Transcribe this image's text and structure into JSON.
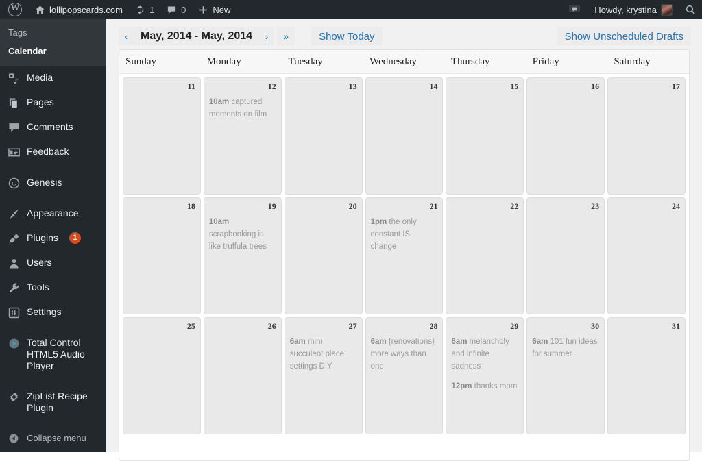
{
  "adminbar": {
    "logo_icon": "wordpress-logo-icon",
    "site_icon": "home-icon",
    "site_name": "lollipopscards.com",
    "updates_icon": "updates-icon",
    "updates_count": "1",
    "comments_icon": "comment-icon",
    "comments_count": "0",
    "new_icon": "plus-icon",
    "new_label": "New",
    "notifications_icon": "notification-bubble-icon",
    "howdy": "Howdy, krystina",
    "avatar_name": "avatar",
    "search_icon": "search-icon"
  },
  "sidebar": {
    "submenu": [
      {
        "label": "Tags",
        "current": false
      },
      {
        "label": "Calendar",
        "current": true
      }
    ],
    "items": [
      {
        "label": "Media",
        "icon": "media-icon",
        "badge": null,
        "sep_before": false
      },
      {
        "label": "Pages",
        "icon": "pages-icon",
        "badge": null,
        "sep_before": false
      },
      {
        "label": "Comments",
        "icon": "comments-icon",
        "badge": null,
        "sep_before": false
      },
      {
        "label": "Feedback",
        "icon": "feedback-icon",
        "badge": null,
        "sep_before": false
      },
      {
        "label": "Genesis",
        "icon": "genesis-icon",
        "badge": null,
        "sep_before": true
      },
      {
        "label": "Appearance",
        "icon": "appearance-icon",
        "badge": null,
        "sep_before": true
      },
      {
        "label": "Plugins",
        "icon": "plugins-icon",
        "badge": "1",
        "sep_before": false
      },
      {
        "label": "Users",
        "icon": "users-icon",
        "badge": null,
        "sep_before": false
      },
      {
        "label": "Tools",
        "icon": "tools-icon",
        "badge": null,
        "sep_before": false
      },
      {
        "label": "Settings",
        "icon": "settings-icon",
        "badge": null,
        "sep_before": false
      },
      {
        "label": "Total Control HTML5 Audio Player",
        "icon": "audio-player-icon",
        "badge": null,
        "sep_before": true
      },
      {
        "label": "ZipList Recipe Plugin",
        "icon": "ziplist-icon",
        "badge": null,
        "sep_before": true
      }
    ],
    "collapse": {
      "label": "Collapse menu",
      "icon": "collapse-arrow-icon"
    }
  },
  "toolbar": {
    "prev_label": "‹",
    "next_label": "›",
    "forward_label": "»",
    "month_range": "May, 2014 - May, 2014",
    "show_today_label": "Show Today",
    "show_drafts_label": "Show Unscheduled Drafts"
  },
  "calendar": {
    "weekday_headers": [
      "Sunday",
      "Monday",
      "Tuesday",
      "Wednesday",
      "Thursday",
      "Friday",
      "Saturday"
    ],
    "weeks": [
      [
        {
          "day": "11",
          "events": []
        },
        {
          "day": "12",
          "events": [
            {
              "time": "10am",
              "title": "captured moments on film"
            }
          ]
        },
        {
          "day": "13",
          "events": []
        },
        {
          "day": "14",
          "events": []
        },
        {
          "day": "15",
          "events": []
        },
        {
          "day": "16",
          "events": []
        },
        {
          "day": "17",
          "events": []
        }
      ],
      [
        {
          "day": "18",
          "events": []
        },
        {
          "day": "19",
          "events": [
            {
              "time": "10am",
              "title": "scrapbooking is like truffula trees"
            }
          ]
        },
        {
          "day": "20",
          "events": []
        },
        {
          "day": "21",
          "events": [
            {
              "time": "1pm",
              "title": "the only constant IS change"
            }
          ]
        },
        {
          "day": "22",
          "events": []
        },
        {
          "day": "23",
          "events": []
        },
        {
          "day": "24",
          "events": []
        }
      ],
      [
        {
          "day": "25",
          "events": []
        },
        {
          "day": "26",
          "events": []
        },
        {
          "day": "27",
          "events": [
            {
              "time": "6am",
              "title": "mini succulent place settings DIY"
            }
          ]
        },
        {
          "day": "28",
          "events": [
            {
              "time": "6am",
              "title": "{renovations} more ways than one"
            }
          ]
        },
        {
          "day": "29",
          "events": [
            {
              "time": "6am",
              "title": "melancholy and infinite sadness"
            },
            {
              "time": "12pm",
              "title": "thanks mom"
            }
          ]
        },
        {
          "day": "30",
          "events": [
            {
              "time": "6am",
              "title": "101 fun ideas for summer"
            }
          ]
        },
        {
          "day": "31",
          "events": []
        }
      ]
    ]
  },
  "colors": {
    "admin_bg": "#23282d",
    "submenu_bg": "#32373c",
    "link_blue": "#2175b9",
    "badge_orange": "#d54e21",
    "cell_bg": "#e9e9e9",
    "canvas": "#f1f1f1"
  }
}
